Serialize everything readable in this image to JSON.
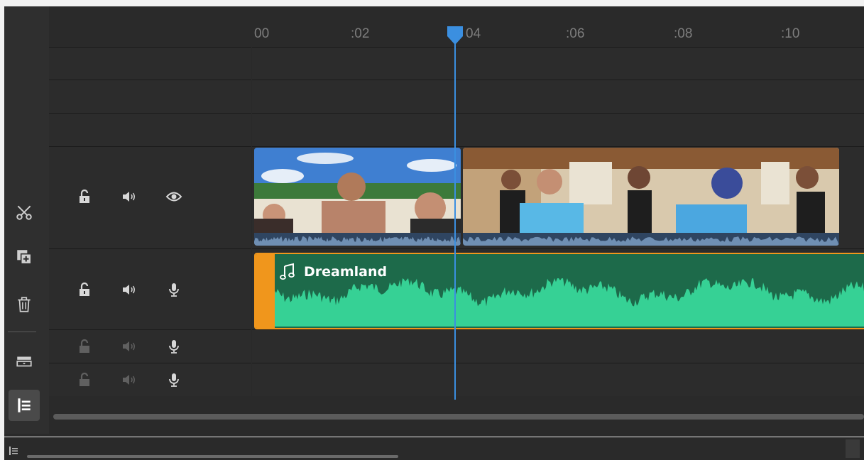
{
  "ruler": {
    "ticks": [
      "00",
      ":02",
      "04",
      ":06",
      ":08",
      ":10"
    ]
  },
  "audio_clip": {
    "title": "Dreamland"
  },
  "icons": {
    "toolbar": [
      "scissors-icon",
      "duplicate-icon",
      "trash-icon",
      "track-height-icon",
      "track-list-icon"
    ],
    "track_controls": [
      "lock-open-icon",
      "speaker-icon",
      "eye-icon",
      "microphone-icon"
    ]
  },
  "colors": {
    "playhead": "#3b8fe0",
    "audio_clip_fill": "#1d6a4a",
    "audio_wave": "#36d195",
    "audio_handle": "#f0961c"
  }
}
